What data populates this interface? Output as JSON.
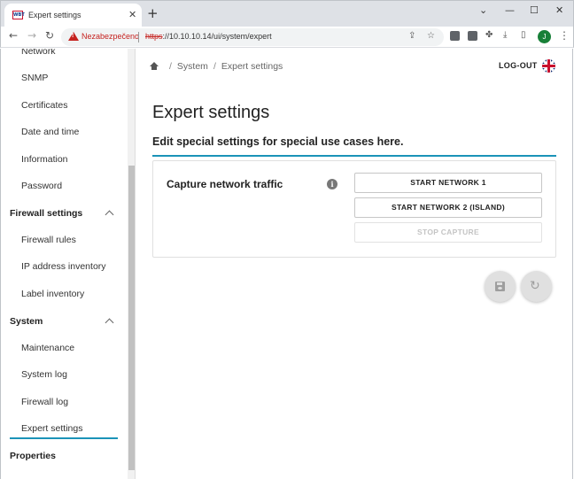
{
  "browser": {
    "tab_title": "Expert settings",
    "favicon_text": "WBT",
    "new_tab": "+",
    "security_warning": "Nezabezpečeno",
    "url_scheme": "https",
    "url_rest": "://10.10.10.14/ui/system/expert",
    "profile_initial": "J"
  },
  "sidebar": {
    "items": [
      {
        "label": "Network"
      },
      {
        "label": "SNMP"
      },
      {
        "label": "Certificates"
      },
      {
        "label": "Date and time"
      },
      {
        "label": "Information"
      },
      {
        "label": "Password"
      }
    ],
    "firewall_section": "Firewall settings",
    "firewall_items": [
      {
        "label": "Firewall rules"
      },
      {
        "label": "IP address inventory"
      },
      {
        "label": "Label inventory"
      }
    ],
    "system_section": "System",
    "system_items": [
      {
        "label": "Maintenance"
      },
      {
        "label": "System log"
      },
      {
        "label": "Firewall log"
      },
      {
        "label": "Expert settings"
      }
    ],
    "properties_section": "Properties",
    "accent_color": "#1b93b8"
  },
  "header": {
    "breadcrumb": [
      "System",
      "Expert settings"
    ],
    "logout": "LOG-OUT"
  },
  "main": {
    "title": "Expert settings",
    "subtitle": "Edit special settings for special use cases here.",
    "capture": {
      "label": "Capture network traffic",
      "info": "i",
      "buttons": {
        "start1": "START NETWORK 1",
        "start2": "START NETWORK 2 (ISLAND)",
        "stop": "STOP CAPTURE"
      }
    }
  }
}
